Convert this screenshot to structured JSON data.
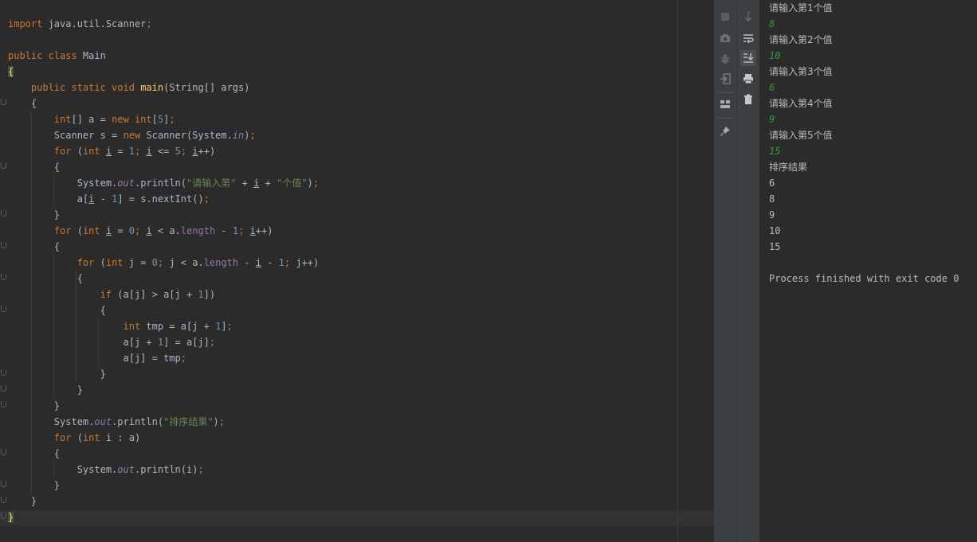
{
  "colors": {
    "editor_bg": "#2b2b2b",
    "keyword": "#cc7832",
    "number": "#6897bb",
    "string": "#6a8759",
    "field": "#9876aa",
    "method": "#ffc66d",
    "text": "#a9b7c6",
    "console_input": "#2f9e3a"
  },
  "editor": {
    "lines": [
      {
        "tokens": [
          {
            "t": "import",
            "c": "kw"
          },
          {
            "t": " java.util.Scanner"
          },
          {
            "t": ";",
            "c": "kw"
          }
        ]
      },
      {
        "tokens": []
      },
      {
        "tokens": [
          {
            "t": "public class",
            "c": "kw"
          },
          {
            "t": " Main"
          }
        ]
      },
      {
        "tokens": [
          {
            "t": "{",
            "c": "brace-hl"
          }
        ]
      },
      {
        "tokens": [
          {
            "t": "    "
          },
          {
            "t": "public static void",
            "c": "kw"
          },
          {
            "t": " "
          },
          {
            "t": "main",
            "c": "fn"
          },
          {
            "t": "(String[] args)"
          }
        ]
      },
      {
        "tokens": [
          {
            "t": "    {"
          }
        ]
      },
      {
        "tokens": [
          {
            "t": "        "
          },
          {
            "t": "int",
            "c": "kw"
          },
          {
            "t": "[] a = "
          },
          {
            "t": "new int",
            "c": "kw"
          },
          {
            "t": "["
          },
          {
            "t": "5",
            "c": "num"
          },
          {
            "t": "]"
          },
          {
            "t": ";",
            "c": "kw"
          }
        ]
      },
      {
        "tokens": [
          {
            "t": "        Scanner s = "
          },
          {
            "t": "new",
            "c": "kw"
          },
          {
            "t": " Scanner(System."
          },
          {
            "t": "in",
            "c": "fld"
          },
          {
            "t": ")"
          },
          {
            "t": ";",
            "c": "kw"
          }
        ]
      },
      {
        "tokens": [
          {
            "t": "        "
          },
          {
            "t": "for",
            "c": "kw"
          },
          {
            "t": " ("
          },
          {
            "t": "int",
            "c": "kw"
          },
          {
            "t": " "
          },
          {
            "t": "i",
            "c": "ul"
          },
          {
            "t": " = "
          },
          {
            "t": "1",
            "c": "num"
          },
          {
            "t": "; ",
            "c": "kw"
          },
          {
            "t": "i",
            "c": "ul"
          },
          {
            "t": " <= "
          },
          {
            "t": "5",
            "c": "num"
          },
          {
            "t": "; ",
            "c": "kw"
          },
          {
            "t": "i",
            "c": "ul"
          },
          {
            "t": "++)"
          }
        ]
      },
      {
        "tokens": [
          {
            "t": "        {"
          }
        ]
      },
      {
        "tokens": [
          {
            "t": "            System."
          },
          {
            "t": "out",
            "c": "fld"
          },
          {
            "t": ".println("
          },
          {
            "t": "\"请输入第\"",
            "c": "str"
          },
          {
            "t": " + "
          },
          {
            "t": "i",
            "c": "ul"
          },
          {
            "t": " + "
          },
          {
            "t": "\"个值\"",
            "c": "str"
          },
          {
            "t": ")"
          },
          {
            "t": ";",
            "c": "kw"
          }
        ]
      },
      {
        "tokens": [
          {
            "t": "            a["
          },
          {
            "t": "i",
            "c": "ul"
          },
          {
            "t": " - "
          },
          {
            "t": "1",
            "c": "num"
          },
          {
            "t": "] = s.nextInt()"
          },
          {
            "t": ";",
            "c": "kw"
          }
        ]
      },
      {
        "tokens": [
          {
            "t": "        }"
          }
        ]
      },
      {
        "tokens": [
          {
            "t": "        "
          },
          {
            "t": "for",
            "c": "kw"
          },
          {
            "t": " ("
          },
          {
            "t": "int",
            "c": "kw"
          },
          {
            "t": " "
          },
          {
            "t": "i",
            "c": "ul"
          },
          {
            "t": " = "
          },
          {
            "t": "0",
            "c": "num"
          },
          {
            "t": "; ",
            "c": "kw"
          },
          {
            "t": "i",
            "c": "ul"
          },
          {
            "t": " < a."
          },
          {
            "t": "length",
            "c": "fld2"
          },
          {
            "t": " - "
          },
          {
            "t": "1",
            "c": "num"
          },
          {
            "t": "; ",
            "c": "kw"
          },
          {
            "t": "i",
            "c": "ul"
          },
          {
            "t": "++)"
          }
        ]
      },
      {
        "tokens": [
          {
            "t": "        {"
          }
        ]
      },
      {
        "tokens": [
          {
            "t": "            "
          },
          {
            "t": "for",
            "c": "kw"
          },
          {
            "t": " ("
          },
          {
            "t": "int",
            "c": "kw"
          },
          {
            "t": " j = "
          },
          {
            "t": "0",
            "c": "num"
          },
          {
            "t": "; ",
            "c": "kw"
          },
          {
            "t": "j < a."
          },
          {
            "t": "length",
            "c": "fld2"
          },
          {
            "t": " - "
          },
          {
            "t": "i",
            "c": "ul"
          },
          {
            "t": " - "
          },
          {
            "t": "1",
            "c": "num"
          },
          {
            "t": "; ",
            "c": "kw"
          },
          {
            "t": "j++)"
          }
        ]
      },
      {
        "tokens": [
          {
            "t": "            {"
          }
        ]
      },
      {
        "tokens": [
          {
            "t": "                "
          },
          {
            "t": "if",
            "c": "kw"
          },
          {
            "t": " (a[j] > a[j + "
          },
          {
            "t": "1",
            "c": "num"
          },
          {
            "t": "])"
          }
        ]
      },
      {
        "tokens": [
          {
            "t": "                {"
          }
        ]
      },
      {
        "tokens": [
          {
            "t": "                    "
          },
          {
            "t": "int",
            "c": "kw"
          },
          {
            "t": " tmp = a[j + "
          },
          {
            "t": "1",
            "c": "num"
          },
          {
            "t": "]"
          },
          {
            "t": ";",
            "c": "kw"
          }
        ]
      },
      {
        "tokens": [
          {
            "t": "                    a[j + "
          },
          {
            "t": "1",
            "c": "num"
          },
          {
            "t": "] = a[j]"
          },
          {
            "t": ";",
            "c": "kw"
          }
        ]
      },
      {
        "tokens": [
          {
            "t": "                    a[j] = tmp"
          },
          {
            "t": ";",
            "c": "kw"
          }
        ]
      },
      {
        "tokens": [
          {
            "t": "                }"
          }
        ]
      },
      {
        "tokens": [
          {
            "t": "            }"
          }
        ]
      },
      {
        "tokens": [
          {
            "t": "        }"
          }
        ]
      },
      {
        "tokens": [
          {
            "t": "        System."
          },
          {
            "t": "out",
            "c": "fld"
          },
          {
            "t": ".println("
          },
          {
            "t": "\"排序结果\"",
            "c": "str"
          },
          {
            "t": ")"
          },
          {
            "t": ";",
            "c": "kw"
          }
        ]
      },
      {
        "tokens": [
          {
            "t": "        "
          },
          {
            "t": "for",
            "c": "kw"
          },
          {
            "t": " ("
          },
          {
            "t": "int",
            "c": "kw"
          },
          {
            "t": " i : a)"
          }
        ]
      },
      {
        "tokens": [
          {
            "t": "        {"
          }
        ]
      },
      {
        "tokens": [
          {
            "t": "            System."
          },
          {
            "t": "out",
            "c": "fld"
          },
          {
            "t": ".println(i)"
          },
          {
            "t": ";",
            "c": "kw"
          }
        ]
      },
      {
        "tokens": [
          {
            "t": "        }"
          }
        ]
      },
      {
        "tokens": [
          {
            "t": "    }"
          }
        ]
      },
      {
        "tokens": [
          {
            "t": "}",
            "c": "brace-hl"
          }
        ]
      }
    ]
  },
  "toolbar_left": [
    {
      "icon": "stop-icon"
    },
    {
      "icon": "camera-icon"
    },
    {
      "icon": "bug-icon"
    },
    {
      "icon": "login-icon"
    },
    {
      "icon": "layout-icon"
    },
    {
      "icon": "pin-icon"
    }
  ],
  "toolbar_right": [
    {
      "icon": "arrow-down-icon"
    },
    {
      "icon": "soft-wrap-icon"
    },
    {
      "icon": "scroll-to-end-icon",
      "active": true
    },
    {
      "icon": "print-icon"
    },
    {
      "icon": "trash-icon"
    }
  ],
  "console": {
    "lines": [
      {
        "text": "请输入第1个值",
        "kind": "out"
      },
      {
        "text": "8",
        "kind": "in"
      },
      {
        "text": "请输入第2个值",
        "kind": "out"
      },
      {
        "text": "10",
        "kind": "in"
      },
      {
        "text": "请输入第3个值",
        "kind": "out"
      },
      {
        "text": "6",
        "kind": "in"
      },
      {
        "text": "请输入第4个值",
        "kind": "out"
      },
      {
        "text": "9",
        "kind": "in"
      },
      {
        "text": "请输入第5个值",
        "kind": "out"
      },
      {
        "text": "15",
        "kind": "in"
      },
      {
        "text": "排序结果",
        "kind": "out"
      },
      {
        "text": "6",
        "kind": "out"
      },
      {
        "text": "8",
        "kind": "out"
      },
      {
        "text": "9",
        "kind": "out"
      },
      {
        "text": "10",
        "kind": "out"
      },
      {
        "text": "15",
        "kind": "out"
      },
      {
        "text": "",
        "kind": "out"
      },
      {
        "text": "Process finished with exit code 0",
        "kind": "out"
      }
    ]
  }
}
